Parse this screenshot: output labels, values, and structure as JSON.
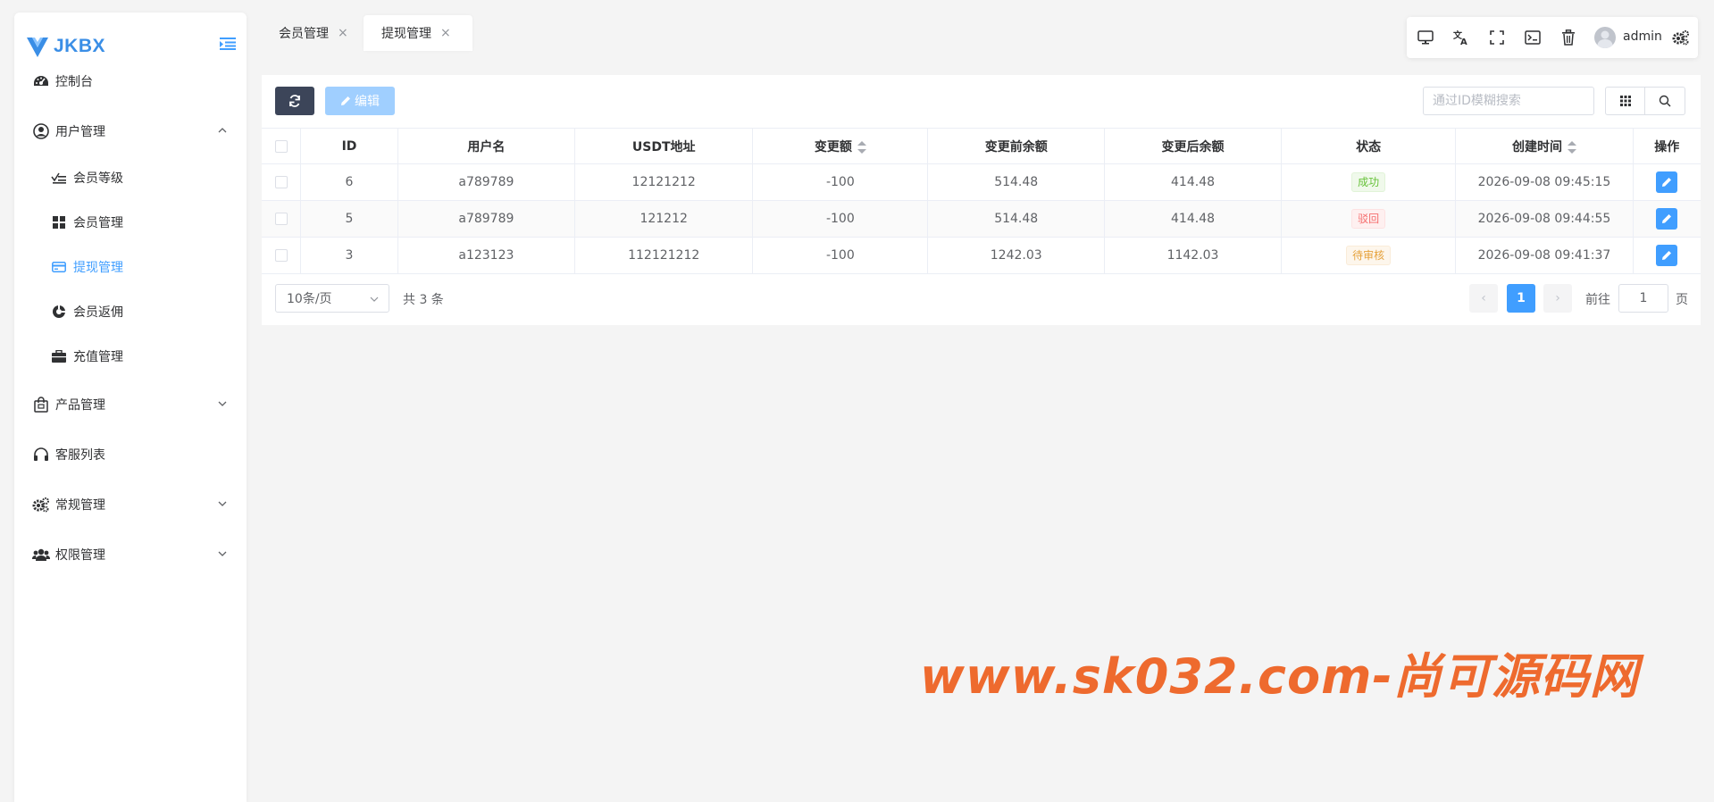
{
  "brand": {
    "name": "JKBX",
    "color": "#3a8ee6"
  },
  "sidebar": {
    "items": [
      {
        "label": "控制台",
        "icon": "dashboard-icon"
      },
      {
        "label": "用户管理",
        "icon": "user-circle-icon",
        "expanded": true,
        "children": [
          {
            "label": "会员等级",
            "icon": "level-icon"
          },
          {
            "label": "会员管理",
            "icon": "grid-icon"
          },
          {
            "label": "提现管理",
            "icon": "card-icon",
            "active": true
          },
          {
            "label": "会员返佣",
            "icon": "commission-icon"
          },
          {
            "label": "充值管理",
            "icon": "briefcase-icon"
          }
        ]
      },
      {
        "label": "产品管理",
        "icon": "shopping-bag-icon"
      },
      {
        "label": "客服列表",
        "icon": "headset-icon"
      },
      {
        "label": "常规管理",
        "icon": "gears-icon"
      },
      {
        "label": "权限管理",
        "icon": "users-icon"
      }
    ]
  },
  "tabs": [
    {
      "label": "会员管理",
      "close": "×"
    },
    {
      "label": "提现管理",
      "close": "×",
      "active": true
    }
  ],
  "toolbar": {
    "username": "admin"
  },
  "actions": {
    "edit_label": "编辑"
  },
  "search": {
    "placeholder": "通过ID模糊搜索"
  },
  "table": {
    "headers": [
      "ID",
      "用户名",
      "USDT地址",
      "变更额",
      "变更前余额",
      "变更后余额",
      "状态",
      "创建时间",
      "操作"
    ],
    "rows": [
      {
        "id": "6",
        "username": "a789789",
        "usdt": "12121212",
        "change": "-100",
        "before": "514.48",
        "after": "414.48",
        "status": "成功",
        "status_type": "success",
        "created": "2026-09-08 09:45:15"
      },
      {
        "id": "5",
        "username": "a789789",
        "usdt": "121212",
        "change": "-100",
        "before": "514.48",
        "after": "414.48",
        "status": "驳回",
        "status_type": "danger",
        "created": "2026-09-08 09:44:55"
      },
      {
        "id": "3",
        "username": "a123123",
        "usdt": "112121212",
        "change": "-100",
        "before": "1242.03",
        "after": "1142.03",
        "status": "待审核",
        "status_type": "warning",
        "created": "2026-09-08 09:41:37"
      }
    ]
  },
  "status_colors": {
    "success": {
      "color": "#67c23a",
      "bg": "#f0f9eb",
      "border": "#e1f3d8"
    },
    "danger": {
      "color": "#f56c6c",
      "bg": "#fef0f0",
      "border": "#fde2e2"
    },
    "warning": {
      "color": "#e6a23c",
      "bg": "#fdf6ec",
      "border": "#faecd8"
    }
  },
  "pagination": {
    "page_size": "10条/页",
    "total_text": "共 3 条",
    "current_page": "1",
    "goto_label": "前往",
    "goto_value": "1",
    "page_suffix": "页",
    "prev": "‹",
    "next": "›"
  },
  "watermark": "www.sk032.com-尚可源码网"
}
